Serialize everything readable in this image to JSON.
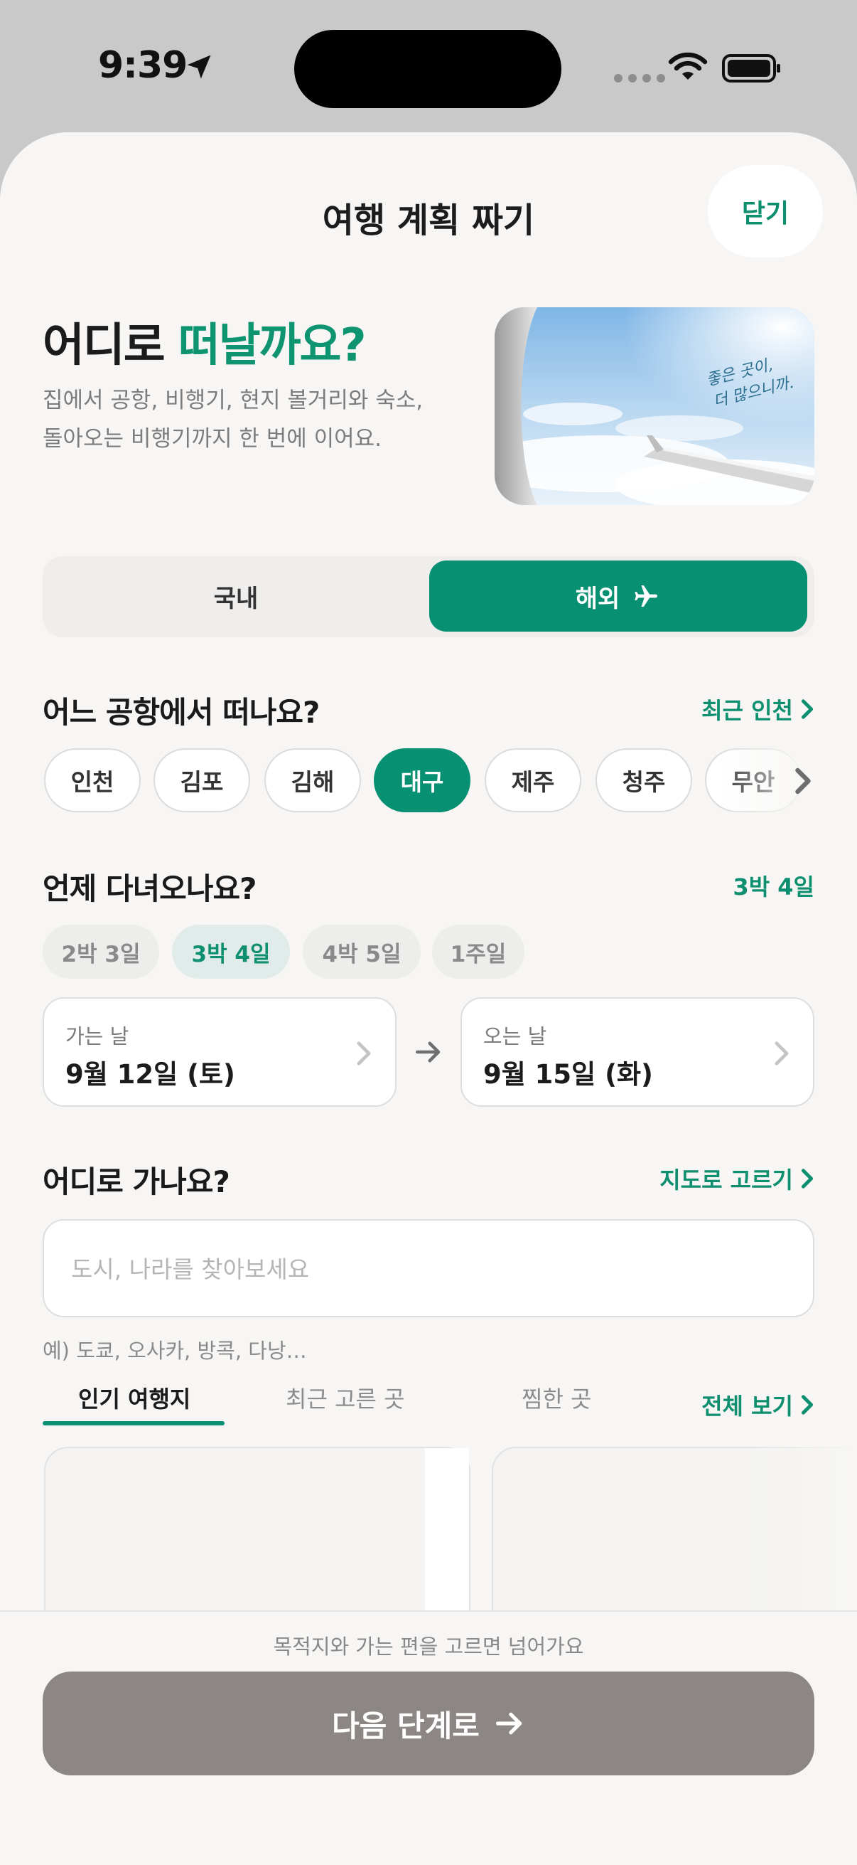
{
  "status_bar": {
    "time": "9:39",
    "icons": [
      "location-arrow-icon",
      "signal-dots-icon",
      "wifi-icon",
      "battery-icon"
    ]
  },
  "header": {
    "title": "여행 계획 짜기",
    "close_label": "닫기"
  },
  "hero": {
    "title_plain": "어디로 ",
    "title_accent": "떠날까요?",
    "subtitle_line1": "집에서 공항, 비행기, 현지 볼거리와 숙소,",
    "subtitle_line2": "돌아오는 비행기까지 한 번에 이어요.",
    "image_caption_line1": "좋은 곳이,",
    "image_caption_line2": "더 많으니까."
  },
  "trip_type": {
    "options": [
      "국내",
      "해외"
    ],
    "selected": "해외",
    "selected_icon": "airplane-icon"
  },
  "departure": {
    "title": "어느 공항에서 떠나요?",
    "recent_link": "최근 인천",
    "airports": [
      "인천",
      "김포",
      "김해",
      "대구",
      "제주",
      "청주",
      "무안"
    ],
    "selected": "대구"
  },
  "dates": {
    "title": "언제 다녀오나요?",
    "summary": "3박 4일",
    "durations": [
      "2박 3일",
      "3박 4일",
      "4박 5일",
      "1주일"
    ],
    "selected_duration": "3박 4일",
    "depart_label": "가는 날",
    "depart_value": "9월 12일 (토)",
    "return_label": "오는 날",
    "return_value": "9월 15일 (화)"
  },
  "destination": {
    "title": "어디로 가나요?",
    "map_link": "지도로 고르기",
    "search_placeholder": "도시, 나라를 찾아보세요",
    "search_value": "",
    "example": "예) 도쿄, 오사카, 방콕, 다낭…",
    "tabs": [
      "인기 여행지",
      "최근 고른 곳",
      "찜한 곳"
    ],
    "selected_tab": "인기 여행지",
    "view_all": "전체 보기"
  },
  "footer": {
    "hint": "목적지와 가는 편을 고르면 넘어가요",
    "next_label": "다음 단계로"
  },
  "colors": {
    "accent": "#079072",
    "accent_text": "#0e8f6f",
    "background": "#f7f6f4",
    "disabled_button": "#8c8784"
  }
}
